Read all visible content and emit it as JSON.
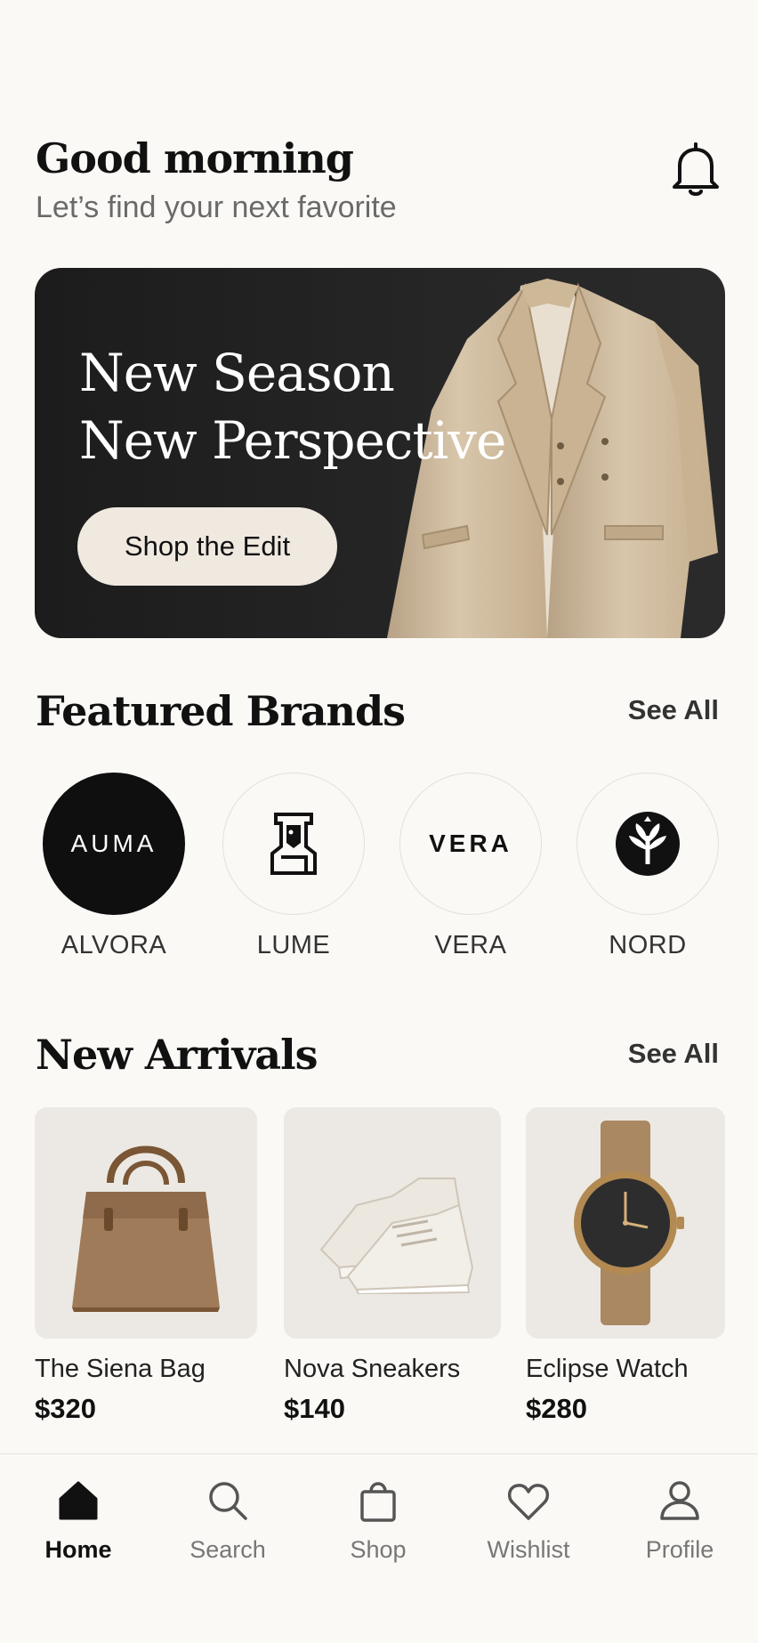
{
  "header": {
    "greeting": "Good morning",
    "subtitle": "Let’s find your next favorite",
    "notification_icon": "bell-icon"
  },
  "hero": {
    "title_line1": "New Season",
    "title_line2": "New Perspective",
    "cta_label": "Shop the Edit",
    "background_color": "#1c1c1c",
    "cta_color": "#f0e9e0"
  },
  "featured_brands": {
    "title": "Featured Brands",
    "see_all": "See All",
    "items": [
      {
        "name": "ALVORA",
        "logo_text": "AUMA",
        "style": "dark"
      },
      {
        "name": "LUME",
        "logo_icon": "figure-logo-icon",
        "style": "light"
      },
      {
        "name": "VERA",
        "logo_text": "VERA",
        "style": "light"
      },
      {
        "name": "NORD",
        "logo_icon": "tree-logo-icon",
        "style": "light"
      }
    ]
  },
  "new_arrivals": {
    "title": "New Arrivals",
    "see_all": "See All",
    "items": [
      {
        "name": "The Siena Bag",
        "price": "$320",
        "icon": "handbag-image"
      },
      {
        "name": "Nova Sneakers",
        "price": "$140",
        "icon": "sneakers-image"
      },
      {
        "name": "Eclipse Watch",
        "price": "$280",
        "icon": "watch-image"
      }
    ]
  },
  "bottom_nav": {
    "items": [
      {
        "label": "Home",
        "icon": "home-icon",
        "active": true
      },
      {
        "label": "Search",
        "icon": "search-icon",
        "active": false
      },
      {
        "label": "Shop",
        "icon": "shopping-bag-icon",
        "active": false
      },
      {
        "label": "Wishlist",
        "icon": "heart-icon",
        "active": false
      },
      {
        "label": "Profile",
        "icon": "user-icon",
        "active": false
      }
    ]
  },
  "colors": {
    "background": "#faf9f6",
    "text_primary": "#111111",
    "text_secondary": "#6a6a6a",
    "product_card": "#ece9e4"
  }
}
